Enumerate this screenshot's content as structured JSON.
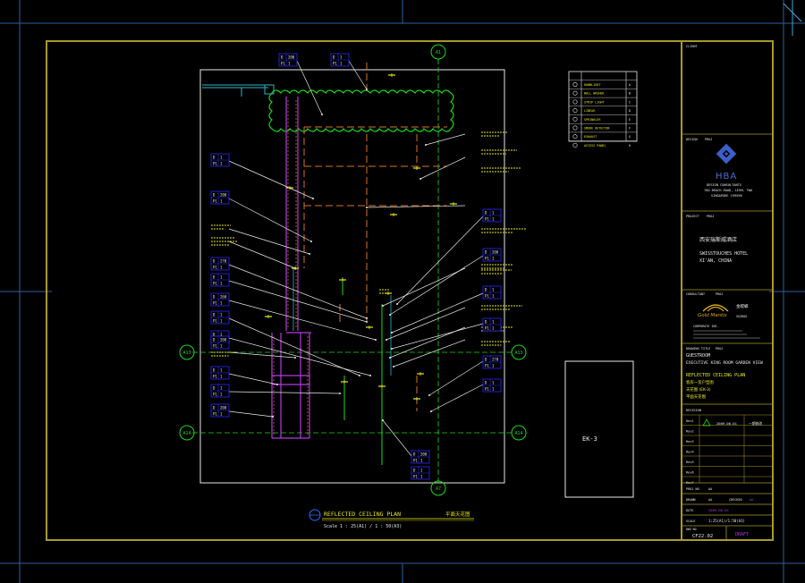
{
  "colors": {
    "frame": "#a89a2a",
    "cyan": "#2fb4c8",
    "outer_line": "#2f5f9f",
    "yellow": "#e8e81a",
    "green": "#19d819",
    "magenta": "#b33ae0",
    "orange": "#d8731c",
    "white": "#e8e8e8",
    "blue_box": "#2a2aff"
  },
  "grid": {
    "a1": "A1",
    "a7": "A7",
    "a13_left": "A13",
    "a13_right": "A13",
    "a14_left": "A14",
    "a14_right": "A14"
  },
  "tags": [
    {
      "top": "D",
      "top2": "200",
      "bot": "P1",
      "bot2": "1"
    },
    {
      "top": "D",
      "top2": "1",
      "bot": "P1",
      "bot2": "1"
    },
    {
      "top": "D",
      "top2": "1",
      "bot": "P1",
      "bot2": "1"
    },
    {
      "top": "D",
      "top2": "200",
      "bot": "P1",
      "bot2": "1"
    },
    {
      "top": "D",
      "top2": "270",
      "bot": "P1",
      "bot2": "1"
    },
    {
      "top": "D",
      "top2": "1",
      "bot": "P1",
      "bot2": "1"
    },
    {
      "top": "D",
      "top2": "260",
      "bot": "P1",
      "bot2": "1"
    },
    {
      "top": "D",
      "top2": "1",
      "bot": "P1",
      "bot2": "1"
    },
    {
      "top": "D",
      "top2": "1",
      "bot": "P1",
      "bot2": "1"
    },
    {
      "top": "D",
      "top2": "1",
      "bot": "P1",
      "bot2": "1"
    },
    {
      "top": "D",
      "top2": "1",
      "bot": "P1",
      "bot2": "1"
    },
    {
      "top": "D",
      "top2": "200",
      "bot": "P1",
      "bot2": "1"
    },
    {
      "top": "D",
      "top2": "1",
      "bot": "P1",
      "bot2": "1"
    },
    {
      "top": "D",
      "top2": "200",
      "bot": "P1",
      "bot2": "1"
    },
    {
      "top": "D",
      "top2": "1",
      "bot": "P1",
      "bot2": "1"
    },
    {
      "top": "D",
      "top2": "270",
      "bot": "P1",
      "bot2": "1"
    },
    {
      "top": "D",
      "top2": "1",
      "bot": "P1",
      "bot2": "1"
    },
    {
      "top": "D",
      "top2": "200",
      "bot": "P1",
      "bot2": "1"
    },
    {
      "top": "D",
      "top2": "1",
      "bot": "P1",
      "bot2": "1"
    },
    {
      "top": "D",
      "top2": "200",
      "bot": "P1",
      "bot2": "1"
    },
    {
      "top": "D",
      "top2": "1",
      "bot": "P1",
      "bot2": "1"
    }
  ],
  "plan_title": {
    "title": "REFLECTED CEILING PLAN",
    "scale": "Scale 1 : 25(A1) / 1 : 50(A3)",
    "chinese": "平面天花图"
  },
  "ek_box": "EK-3",
  "title_block": {
    "client_label": "CLIENT",
    "design_label": "DESIGN",
    "design_label2": "PROJ",
    "hba": "HBA",
    "hba_sub1": "DESIGN CONSULTANTS",
    "hba_sub2": "700 BEACH ROAD, LEVEL TWO",
    "hba_sub3": "SINGAPORE 199598",
    "project_label": "PROJECT",
    "project_label2": "PROJ",
    "project_cn": "西安瑞斯威酒店",
    "project_en1": "SWISSTOUCHES HOTEL",
    "project_en2": "XI'AN, CHINA",
    "consultant_label": "CONSULTANT",
    "consultant_label2": "PROJ",
    "gold_mantis": "Gold Mantis",
    "gold_mantis_cn": "金螳螂",
    "gm_sub1": "CORPORATE INC.",
    "gm_sub2": "SUZHOU",
    "drawing_title_label": "DRAWING TITLE",
    "drawing_title_label2": "PROJ",
    "room1": "GUESTROOM",
    "room2": "EXECUTIVE KING ROOM GARDEN VIEW",
    "sheet_title": "REFLECTED CEILING PLAN",
    "sheet_cn1": "客房一室户型图",
    "sheet_cn2": "天花图 (EK-3)",
    "sheet_cn3": "平面天花图",
    "rev_label": "REVISION",
    "rev_rows": [
      "Rev1",
      "Rev2",
      "Rev3",
      "Rev4",
      "Rev5",
      "Rev6",
      "Rev7"
    ],
    "rev_date": "2009.06.01",
    "rev_note": "一期修改",
    "proj_no_label": "PROJ NO",
    "proj_no_val": "AA",
    "drawn_label": "DRAWN",
    "drawn_val": "AA",
    "checked_label": "CHECKED",
    "checked_val": "AA",
    "date_label": "DATE",
    "date_val": "2009.06.01",
    "scale_label": "SCALE",
    "scale_val": "1:25(A1)/1:50(A3)",
    "dwg_no_label": "DWG NO",
    "dwg_no": "CF22.02",
    "stamp": "DRAFT"
  },
  "legend_rows": [
    {
      "code": "A",
      "desc": "DOWNLIGHT"
    },
    {
      "code": "B",
      "desc": "WALL WASHER"
    },
    {
      "code": "C",
      "desc": "STRIP LIGHT"
    },
    {
      "code": "D",
      "desc": "LINEAR"
    },
    {
      "code": "E",
      "desc": "SPRINKLER"
    },
    {
      "code": "F",
      "desc": "SMOKE DETECTOR"
    },
    {
      "code": "G",
      "desc": "EXHAUST"
    },
    {
      "code": "H",
      "desc": "ACCESS PANEL"
    }
  ]
}
